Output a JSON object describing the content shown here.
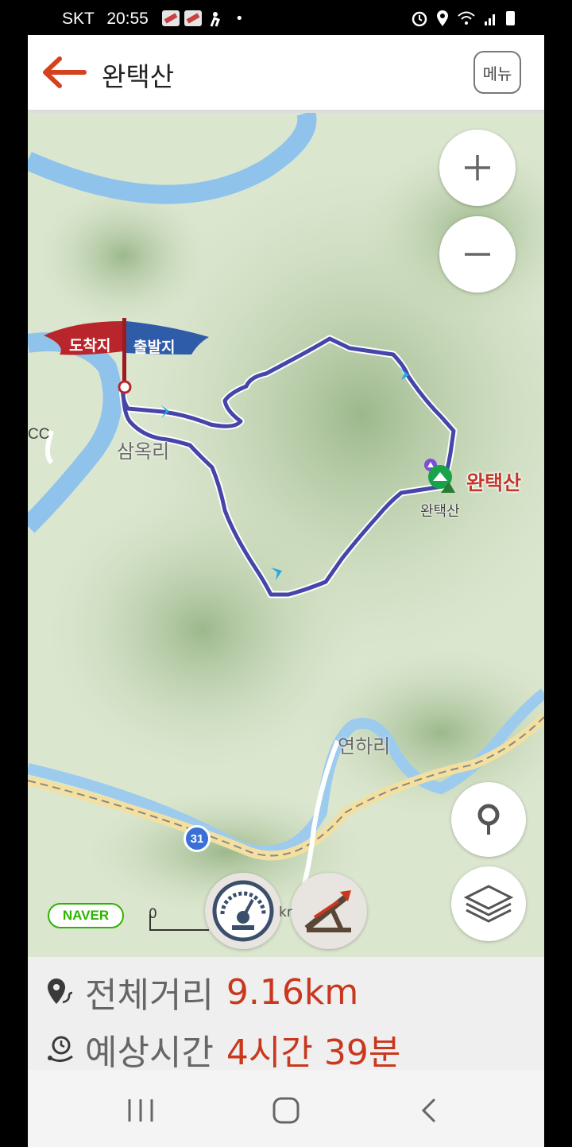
{
  "status_bar": {
    "carrier": "SKT",
    "time": "20:55",
    "dot": "•"
  },
  "header": {
    "title": "완택산",
    "menu_label": "메뉴"
  },
  "map": {
    "flag_end_label": "도착지",
    "flag_start_label": "출발지",
    "places": {
      "village_samok": "삼옥리",
      "village_yeonha": "연하리",
      "edge_label": "CC",
      "road_number": "31"
    },
    "summit": {
      "name": "완택산",
      "sub_name": "완택산"
    },
    "attribution": "NAVER",
    "scale_start": "0",
    "scale_end_partial": "kr"
  },
  "colors": {
    "accent": "#c9381e",
    "route": "#3f3fa8",
    "flag_red": "#b8262c",
    "flag_blue": "#2f5ca8"
  },
  "info": {
    "distance_label": "전체거리",
    "distance_value": "9.16km",
    "time_label": "예상시간",
    "time_value": "4시간 39분"
  },
  "nav": {
    "recents_icon": "recents-icon",
    "home_icon": "home-icon",
    "back_icon": "back-icon"
  }
}
